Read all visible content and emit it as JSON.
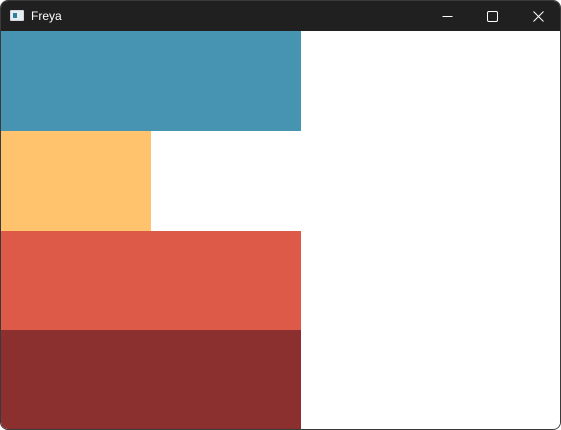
{
  "window": {
    "title": "Freya",
    "icon": "app-window-icon",
    "controls": {
      "minimize": "minimize-icon",
      "maximize": "maximize-icon",
      "close": "close-icon"
    }
  },
  "colors": {
    "titlebar": "#202020",
    "client_background": "#ffffff",
    "blue_block": "#4794b2",
    "yellow_block": "#ffc36e",
    "red_block": "#de5a48",
    "darkred_block": "#8b302e"
  }
}
